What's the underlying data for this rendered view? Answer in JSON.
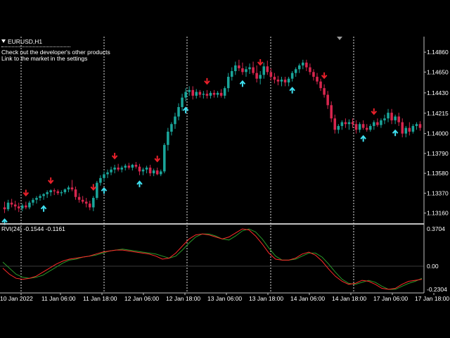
{
  "window": {
    "symbol_label": "EURUSD,H1",
    "note_line1": "Check out the developer's other products",
    "note_line2": "Link to the market in the settings",
    "indicator_label": "RVI(24) -0.1544 -0.1161"
  },
  "colors": {
    "background": "#000000",
    "bull_candle": "#1aa59a",
    "bear_candle": "#d8264e",
    "up_arrow": "#3fe0f0",
    "down_arrow": "#e8202a",
    "rvi_main": "#ff2a2a",
    "rvi_signal": "#2a9a2a",
    "separator": "#c0c0c0"
  },
  "price_axis": {
    "labels": [
      "1.14860",
      "1.14650",
      "1.14430",
      "1.14215",
      "1.14000",
      "1.13790",
      "1.13580",
      "1.13370",
      "1.13160"
    ],
    "range": [
      1.1306,
      1.1495
    ]
  },
  "indicator_axis": {
    "labels": [
      "0.3704",
      "0.00",
      "-0.2304"
    ],
    "range": [
      -0.2304,
      0.3704
    ]
  },
  "time_axis": {
    "labels": [
      "10 Jan 2022",
      "11 Jan 06:00",
      "11 Jan 18:00",
      "12 Jan 06:00",
      "12 Jan 18:00",
      "13 Jan 06:00",
      "13 Jan 18:00",
      "14 Jan 06:00",
      "14 Jan 18:00",
      "17 Jan 06:00",
      "17 Jan 18:00"
    ]
  },
  "chart_data": {
    "type": "candlestick",
    "symbol": "EURUSD",
    "timeframe": "H1",
    "candles": [
      {
        "o": 1.1322,
        "h": 1.1328,
        "l": 1.1316,
        "c": 1.132
      },
      {
        "o": 1.132,
        "h": 1.133,
        "l": 1.1318,
        "c": 1.1327
      },
      {
        "o": 1.1327,
        "h": 1.1331,
        "l": 1.1322,
        "c": 1.1325
      },
      {
        "o": 1.1325,
        "h": 1.1329,
        "l": 1.1319,
        "c": 1.1323
      },
      {
        "o": 1.1323,
        "h": 1.1327,
        "l": 1.1317,
        "c": 1.1321
      },
      {
        "o": 1.1321,
        "h": 1.1326,
        "l": 1.1318,
        "c": 1.1324
      },
      {
        "o": 1.1324,
        "h": 1.1328,
        "l": 1.132,
        "c": 1.1322
      },
      {
        "o": 1.1322,
        "h": 1.1329,
        "l": 1.132,
        "c": 1.1327
      },
      {
        "o": 1.1327,
        "h": 1.1332,
        "l": 1.1324,
        "c": 1.133
      },
      {
        "o": 1.133,
        "h": 1.1334,
        "l": 1.1326,
        "c": 1.1332
      },
      {
        "o": 1.1332,
        "h": 1.1336,
        "l": 1.1329,
        "c": 1.1334
      },
      {
        "o": 1.1334,
        "h": 1.1337,
        "l": 1.133,
        "c": 1.1336
      },
      {
        "o": 1.1336,
        "h": 1.134,
        "l": 1.1332,
        "c": 1.1338
      },
      {
        "o": 1.1338,
        "h": 1.1341,
        "l": 1.1334,
        "c": 1.134
      },
      {
        "o": 1.134,
        "h": 1.1342,
        "l": 1.1335,
        "c": 1.1339
      },
      {
        "o": 1.1339,
        "h": 1.1341,
        "l": 1.1335,
        "c": 1.1337
      },
      {
        "o": 1.1337,
        "h": 1.134,
        "l": 1.1334,
        "c": 1.1338
      },
      {
        "o": 1.1338,
        "h": 1.1342,
        "l": 1.1336,
        "c": 1.1341
      },
      {
        "o": 1.1341,
        "h": 1.1345,
        "l": 1.1338,
        "c": 1.1343
      },
      {
        "o": 1.1343,
        "h": 1.1351,
        "l": 1.1339,
        "c": 1.1341
      },
      {
        "o": 1.1341,
        "h": 1.1344,
        "l": 1.133,
        "c": 1.1333
      },
      {
        "o": 1.1333,
        "h": 1.1337,
        "l": 1.1327,
        "c": 1.133
      },
      {
        "o": 1.133,
        "h": 1.1334,
        "l": 1.1326,
        "c": 1.1328
      },
      {
        "o": 1.1328,
        "h": 1.1332,
        "l": 1.1322,
        "c": 1.1326
      },
      {
        "o": 1.1326,
        "h": 1.1329,
        "l": 1.1319,
        "c": 1.1322
      },
      {
        "o": 1.1322,
        "h": 1.1334,
        "l": 1.1318,
        "c": 1.1332
      },
      {
        "o": 1.1332,
        "h": 1.135,
        "l": 1.133,
        "c": 1.1348
      },
      {
        "o": 1.1348,
        "h": 1.1356,
        "l": 1.1345,
        "c": 1.1353
      },
      {
        "o": 1.1353,
        "h": 1.136,
        "l": 1.1349,
        "c": 1.1357
      },
      {
        "o": 1.1357,
        "h": 1.1362,
        "l": 1.1353,
        "c": 1.1359
      },
      {
        "o": 1.1359,
        "h": 1.1365,
        "l": 1.1356,
        "c": 1.1362
      },
      {
        "o": 1.1362,
        "h": 1.1367,
        "l": 1.1358,
        "c": 1.1364
      },
      {
        "o": 1.1364,
        "h": 1.1368,
        "l": 1.136,
        "c": 1.1362
      },
      {
        "o": 1.1362,
        "h": 1.1366,
        "l": 1.1359,
        "c": 1.1364
      },
      {
        "o": 1.1364,
        "h": 1.1368,
        "l": 1.1361,
        "c": 1.1366
      },
      {
        "o": 1.1366,
        "h": 1.1369,
        "l": 1.1362,
        "c": 1.1364
      },
      {
        "o": 1.1364,
        "h": 1.1368,
        "l": 1.1361,
        "c": 1.1367
      },
      {
        "o": 1.1367,
        "h": 1.137,
        "l": 1.1363,
        "c": 1.1365
      },
      {
        "o": 1.1365,
        "h": 1.1368,
        "l": 1.1356,
        "c": 1.136
      },
      {
        "o": 1.136,
        "h": 1.1364,
        "l": 1.1356,
        "c": 1.1362
      },
      {
        "o": 1.1362,
        "h": 1.1366,
        "l": 1.1358,
        "c": 1.1364
      },
      {
        "o": 1.1364,
        "h": 1.1367,
        "l": 1.1355,
        "c": 1.1358
      },
      {
        "o": 1.1358,
        "h": 1.1363,
        "l": 1.1355,
        "c": 1.1361
      },
      {
        "o": 1.1361,
        "h": 1.1364,
        "l": 1.1356,
        "c": 1.1357
      },
      {
        "o": 1.1357,
        "h": 1.1362,
        "l": 1.1355,
        "c": 1.136
      },
      {
        "o": 1.136,
        "h": 1.139,
        "l": 1.1358,
        "c": 1.1388
      },
      {
        "o": 1.1388,
        "h": 1.1406,
        "l": 1.1382,
        "c": 1.1402
      },
      {
        "o": 1.1402,
        "h": 1.1412,
        "l": 1.1398,
        "c": 1.141
      },
      {
        "o": 1.141,
        "h": 1.1422,
        "l": 1.1405,
        "c": 1.1418
      },
      {
        "o": 1.1418,
        "h": 1.1432,
        "l": 1.1414,
        "c": 1.1428
      },
      {
        "o": 1.1428,
        "h": 1.1442,
        "l": 1.1424,
        "c": 1.1438
      },
      {
        "o": 1.1438,
        "h": 1.1448,
        "l": 1.1434,
        "c": 1.1444
      },
      {
        "o": 1.1444,
        "h": 1.145,
        "l": 1.144,
        "c": 1.1446
      },
      {
        "o": 1.1446,
        "h": 1.145,
        "l": 1.1436,
        "c": 1.144
      },
      {
        "o": 1.144,
        "h": 1.1447,
        "l": 1.1437,
        "c": 1.1444
      },
      {
        "o": 1.1444,
        "h": 1.1446,
        "l": 1.1438,
        "c": 1.1441
      },
      {
        "o": 1.1441,
        "h": 1.1445,
        "l": 1.1437,
        "c": 1.1442
      },
      {
        "o": 1.1442,
        "h": 1.1446,
        "l": 1.1437,
        "c": 1.144
      },
      {
        "o": 1.144,
        "h": 1.1445,
        "l": 1.1437,
        "c": 1.1443
      },
      {
        "o": 1.1443,
        "h": 1.1446,
        "l": 1.1438,
        "c": 1.1441
      },
      {
        "o": 1.1441,
        "h": 1.1445,
        "l": 1.1438,
        "c": 1.1443
      },
      {
        "o": 1.1443,
        "h": 1.1447,
        "l": 1.1438,
        "c": 1.144
      },
      {
        "o": 1.144,
        "h": 1.145,
        "l": 1.1437,
        "c": 1.1448
      },
      {
        "o": 1.1448,
        "h": 1.1464,
        "l": 1.1444,
        "c": 1.146
      },
      {
        "o": 1.146,
        "h": 1.147,
        "l": 1.1456,
        "c": 1.1466
      },
      {
        "o": 1.1466,
        "h": 1.1476,
        "l": 1.1462,
        "c": 1.1472
      },
      {
        "o": 1.1472,
        "h": 1.1478,
        "l": 1.1466,
        "c": 1.1469
      },
      {
        "o": 1.1469,
        "h": 1.1475,
        "l": 1.1462,
        "c": 1.1465
      },
      {
        "o": 1.1465,
        "h": 1.1471,
        "l": 1.146,
        "c": 1.1468
      },
      {
        "o": 1.1468,
        "h": 1.1474,
        "l": 1.1463,
        "c": 1.147
      },
      {
        "o": 1.147,
        "h": 1.1476,
        "l": 1.1462,
        "c": 1.1464
      },
      {
        "o": 1.1464,
        "h": 1.1472,
        "l": 1.1454,
        "c": 1.1458
      },
      {
        "o": 1.1458,
        "h": 1.1466,
        "l": 1.1452,
        "c": 1.1462
      },
      {
        "o": 1.1462,
        "h": 1.1475,
        "l": 1.1458,
        "c": 1.1471
      },
      {
        "o": 1.1471,
        "h": 1.1477,
        "l": 1.1462,
        "c": 1.1465
      },
      {
        "o": 1.1465,
        "h": 1.1469,
        "l": 1.1456,
        "c": 1.146
      },
      {
        "o": 1.146,
        "h": 1.1464,
        "l": 1.1453,
        "c": 1.1457
      },
      {
        "o": 1.1457,
        "h": 1.1461,
        "l": 1.1451,
        "c": 1.1455
      },
      {
        "o": 1.1455,
        "h": 1.146,
        "l": 1.145,
        "c": 1.1457
      },
      {
        "o": 1.1457,
        "h": 1.146,
        "l": 1.145,
        "c": 1.1454
      },
      {
        "o": 1.1454,
        "h": 1.146,
        "l": 1.145,
        "c": 1.1458
      },
      {
        "o": 1.1458,
        "h": 1.1466,
        "l": 1.1455,
        "c": 1.1464
      },
      {
        "o": 1.1464,
        "h": 1.147,
        "l": 1.146,
        "c": 1.1468
      },
      {
        "o": 1.1468,
        "h": 1.1474,
        "l": 1.1464,
        "c": 1.1472
      },
      {
        "o": 1.1472,
        "h": 1.1478,
        "l": 1.1468,
        "c": 1.1475
      },
      {
        "o": 1.1475,
        "h": 1.1478,
        "l": 1.1466,
        "c": 1.147
      },
      {
        "o": 1.147,
        "h": 1.1474,
        "l": 1.1462,
        "c": 1.1465
      },
      {
        "o": 1.1465,
        "h": 1.1468,
        "l": 1.1456,
        "c": 1.146
      },
      {
        "o": 1.146,
        "h": 1.1464,
        "l": 1.1452,
        "c": 1.1455
      },
      {
        "o": 1.1455,
        "h": 1.1458,
        "l": 1.1445,
        "c": 1.1448
      },
      {
        "o": 1.1448,
        "h": 1.1452,
        "l": 1.1438,
        "c": 1.1441
      },
      {
        "o": 1.1441,
        "h": 1.1445,
        "l": 1.1426,
        "c": 1.143
      },
      {
        "o": 1.143,
        "h": 1.1434,
        "l": 1.1412,
        "c": 1.1416
      },
      {
        "o": 1.1416,
        "h": 1.142,
        "l": 1.14,
        "c": 1.1404
      },
      {
        "o": 1.1404,
        "h": 1.141,
        "l": 1.14,
        "c": 1.1408
      },
      {
        "o": 1.1408,
        "h": 1.1414,
        "l": 1.1404,
        "c": 1.1412
      },
      {
        "o": 1.1412,
        "h": 1.1416,
        "l": 1.1406,
        "c": 1.141
      },
      {
        "o": 1.141,
        "h": 1.1415,
        "l": 1.1404,
        "c": 1.1412
      },
      {
        "o": 1.1412,
        "h": 1.1416,
        "l": 1.1406,
        "c": 1.141
      },
      {
        "o": 1.141,
        "h": 1.1414,
        "l": 1.14,
        "c": 1.1404
      },
      {
        "o": 1.1404,
        "h": 1.1412,
        "l": 1.1401,
        "c": 1.141
      },
      {
        "o": 1.141,
        "h": 1.1414,
        "l": 1.1404,
        "c": 1.1406
      },
      {
        "o": 1.1406,
        "h": 1.141,
        "l": 1.1402,
        "c": 1.1404
      },
      {
        "o": 1.1404,
        "h": 1.141,
        "l": 1.1402,
        "c": 1.1408
      },
      {
        "o": 1.1408,
        "h": 1.1414,
        "l": 1.1404,
        "c": 1.1412
      },
      {
        "o": 1.1412,
        "h": 1.1416,
        "l": 1.1407,
        "c": 1.1409
      },
      {
        "o": 1.1409,
        "h": 1.1416,
        "l": 1.1406,
        "c": 1.1414
      },
      {
        "o": 1.1414,
        "h": 1.142,
        "l": 1.141,
        "c": 1.1416
      },
      {
        "o": 1.1416,
        "h": 1.1426,
        "l": 1.1412,
        "c": 1.1422
      },
      {
        "o": 1.1422,
        "h": 1.1426,
        "l": 1.141,
        "c": 1.1414
      },
      {
        "o": 1.1414,
        "h": 1.142,
        "l": 1.141,
        "c": 1.1418
      },
      {
        "o": 1.1418,
        "h": 1.1422,
        "l": 1.1408,
        "c": 1.1412
      },
      {
        "o": 1.1412,
        "h": 1.1416,
        "l": 1.1396,
        "c": 1.14
      },
      {
        "o": 1.14,
        "h": 1.1408,
        "l": 1.1396,
        "c": 1.1406
      },
      {
        "o": 1.1406,
        "h": 1.1412,
        "l": 1.1398,
        "c": 1.1402
      },
      {
        "o": 1.1402,
        "h": 1.141,
        "l": 1.14,
        "c": 1.1408
      },
      {
        "o": 1.1408,
        "h": 1.1412,
        "l": 1.1404,
        "c": 1.141
      },
      {
        "o": 1.141,
        "h": 1.1413,
        "l": 1.1403,
        "c": 1.1406
      }
    ],
    "up_arrows": [
      0,
      11,
      28,
      38,
      51,
      67,
      81,
      101,
      110
    ],
    "down_arrows": [
      6,
      13,
      25,
      31,
      43,
      57,
      72,
      90,
      104,
      119
    ],
    "rvi": {
      "main": [
        -0.02,
        -0.08,
        -0.12,
        -0.13,
        -0.12,
        -0.1,
        -0.06,
        -0.02,
        0.02,
        0.05,
        0.07,
        0.08,
        0.09,
        0.1,
        0.12,
        0.14,
        0.15,
        0.16,
        0.16,
        0.15,
        0.14,
        0.13,
        0.12,
        0.1,
        0.07,
        0.08,
        0.13,
        0.2,
        0.27,
        0.31,
        0.32,
        0.31,
        0.29,
        0.27,
        0.29,
        0.33,
        0.37,
        0.36,
        0.3,
        0.22,
        0.13,
        0.07,
        0.06,
        0.06,
        0.08,
        0.12,
        0.14,
        0.11,
        0.05,
        -0.03,
        -0.1,
        -0.15,
        -0.18,
        -0.17,
        -0.14,
        -0.15,
        -0.18,
        -0.22,
        -0.23,
        -0.22,
        -0.18,
        -0.15,
        -0.14,
        -0.13
      ],
      "signal": [
        0.04,
        -0.02,
        -0.08,
        -0.11,
        -0.12,
        -0.11,
        -0.09,
        -0.05,
        -0.01,
        0.03,
        0.06,
        0.07,
        0.09,
        0.1,
        0.11,
        0.13,
        0.15,
        0.16,
        0.17,
        0.16,
        0.15,
        0.14,
        0.13,
        0.12,
        0.1,
        0.08,
        0.1,
        0.16,
        0.23,
        0.29,
        0.32,
        0.32,
        0.3,
        0.27,
        0.26,
        0.3,
        0.35,
        0.37,
        0.34,
        0.27,
        0.18,
        0.1,
        0.06,
        0.06,
        0.07,
        0.1,
        0.13,
        0.13,
        0.09,
        0.02,
        -0.06,
        -0.13,
        -0.17,
        -0.18,
        -0.16,
        -0.14,
        -0.16,
        -0.2,
        -0.23,
        -0.23,
        -0.2,
        -0.17,
        -0.15,
        -0.12
      ],
      "zero_line": 0.0
    }
  }
}
